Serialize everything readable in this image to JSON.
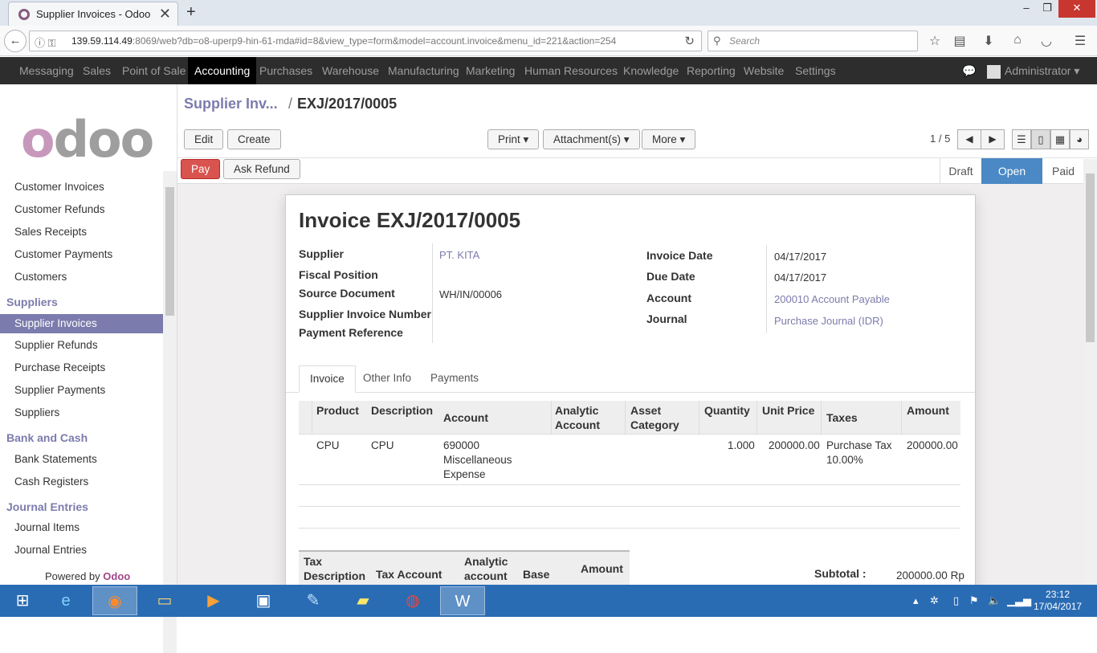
{
  "browser": {
    "tab_title": "Supplier Invoices - Odoo",
    "url_host": "139.59.114.49",
    "url_rest": ":8069/web?db=o8-uperp9-hin-61-mda#id=8&view_type=form&model=account.invoice&menu_id=221&action=254",
    "search_placeholder": "Search"
  },
  "topmenu": {
    "items": [
      "Messaging",
      "Sales",
      "Point of Sale",
      "Accounting",
      "Purchases",
      "Warehouse",
      "Manufacturing",
      "Marketing",
      "Human Resources",
      "Knowledge",
      "Reporting",
      "Website",
      "Settings"
    ],
    "active": "Accounting",
    "user": "Administrator"
  },
  "sidebar": {
    "logo": "odoo",
    "customers_items": [
      "Customer Invoices",
      "Customer Refunds",
      "Sales Receipts",
      "Customer Payments",
      "Customers"
    ],
    "suppliers_head": "Suppliers",
    "suppliers_items": [
      "Supplier Invoices",
      "Supplier Refunds",
      "Purchase Receipts",
      "Supplier Payments",
      "Suppliers"
    ],
    "bank_head": "Bank and Cash",
    "bank_items": [
      "Bank Statements",
      "Cash Registers"
    ],
    "journal_head": "Journal Entries",
    "journal_items": [
      "Journal Items",
      "Journal Entries"
    ],
    "powered_by": "Powered by",
    "powered_brand": "Odoo"
  },
  "breadcrumb": {
    "parent": "Supplier Inv...",
    "separator": "/",
    "current": "EXJ/2017/0005"
  },
  "buttons": {
    "edit": "Edit",
    "create": "Create",
    "print": "Print",
    "attachments": "Attachment(s)",
    "more": "More",
    "pay": "Pay",
    "ask_refund": "Ask Refund"
  },
  "pager": {
    "text": "1 / 5"
  },
  "status": {
    "draft": "Draft",
    "open": "Open",
    "paid": "Paid",
    "current": "Open"
  },
  "invoice": {
    "title": "Invoice EXJ/2017/0005",
    "labels": {
      "supplier": "Supplier",
      "fiscal_position": "Fiscal Position",
      "source_document": "Source Document",
      "supplier_invoice_number": "Supplier Invoice Number",
      "payment_reference": "Payment Reference",
      "invoice_date": "Invoice Date",
      "due_date": "Due Date",
      "account": "Account",
      "journal": "Journal"
    },
    "values": {
      "supplier": "PT. KITA",
      "source_document": "WH/IN/00006",
      "invoice_date": "04/17/2017",
      "due_date": "04/17/2017",
      "account": "200010 Account Payable",
      "journal": "Purchase Journal (IDR)"
    }
  },
  "tabs": [
    "Invoice",
    "Other Info",
    "Payments"
  ],
  "lines": {
    "headers": {
      "product": "Product",
      "description": "Description",
      "account": "Account",
      "analytic1": "Analytic",
      "analytic2": "Account",
      "asset1": "Asset",
      "asset2": "Category",
      "quantity": "Quantity",
      "unit_price": "Unit Price",
      "taxes": "Taxes",
      "amount": "Amount"
    },
    "row": {
      "product": "CPU",
      "description": "CPU",
      "account1": "690000",
      "account2": "Miscellaneous",
      "account3": "Expense",
      "quantity": "1.000",
      "unit_price": "200000.00",
      "taxes1": "Purchase Tax",
      "taxes2": "10.00%",
      "amount": "200000.00"
    }
  },
  "tax_table": {
    "h_desc": "Tax",
    "h_desc2": "Description",
    "h_account": "Tax Account",
    "h_analytic": "Analytic",
    "h_analytic2": "account",
    "h_base": "Base",
    "h_amount": "Amount"
  },
  "totals": {
    "subtotal_label": "Subtotal :",
    "subtotal_value": "200000.00 Rp"
  },
  "taskbar": {
    "time": "23:12",
    "date": "17/04/2017"
  }
}
